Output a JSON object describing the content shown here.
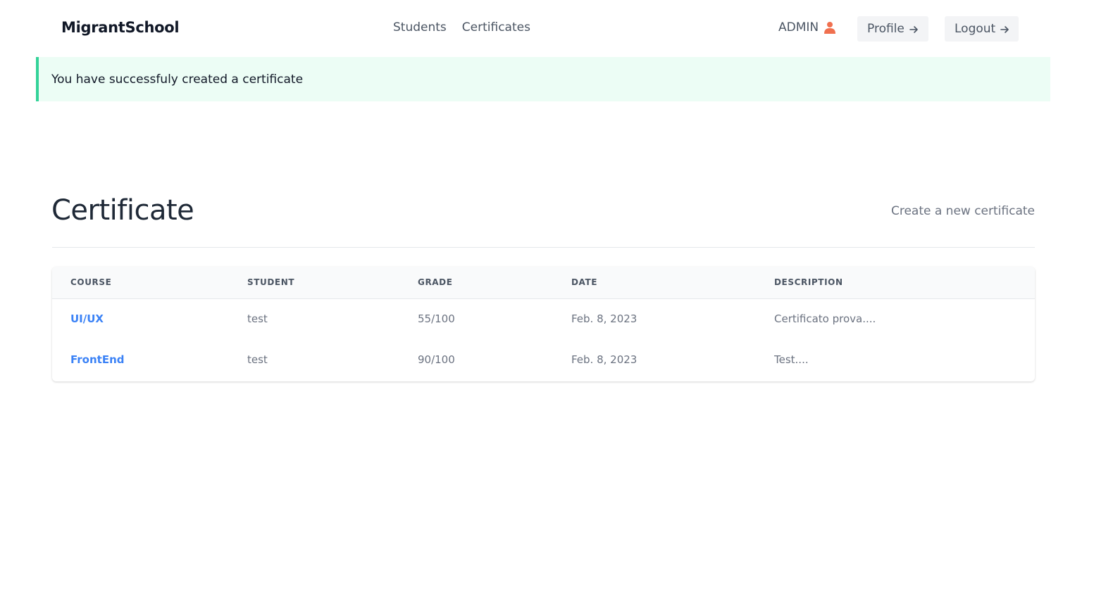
{
  "header": {
    "brand": "MigrantSchool",
    "nav": [
      {
        "label": "Students"
      },
      {
        "label": "Certificates"
      }
    ],
    "user_label": "ADMIN",
    "profile_label": "Profile",
    "logout_label": "Logout"
  },
  "alert": {
    "message": "You have successfuly created a certificate"
  },
  "page": {
    "title": "Certificate",
    "create_link": "Create a new certificate"
  },
  "table": {
    "columns": [
      "COURSE",
      "STUDENT",
      "GRADE",
      "DATE",
      "DESCRIPTION"
    ],
    "rows": [
      {
        "course": "UI/UX",
        "student": "test",
        "grade": "55/100",
        "date": "Feb. 8, 2023",
        "description": "Certificato prova...."
      },
      {
        "course": "FrontEnd",
        "student": "test",
        "grade": "90/100",
        "date": "Feb. 8, 2023",
        "description": "Test...."
      }
    ]
  },
  "colors": {
    "accent": "#3b82f6",
    "success_bg": "#ecfdf5",
    "success_border": "#34d399",
    "user_icon": "#f0704f"
  },
  "icons": {
    "user": "user-icon",
    "arrow": "arrow-right-icon"
  }
}
